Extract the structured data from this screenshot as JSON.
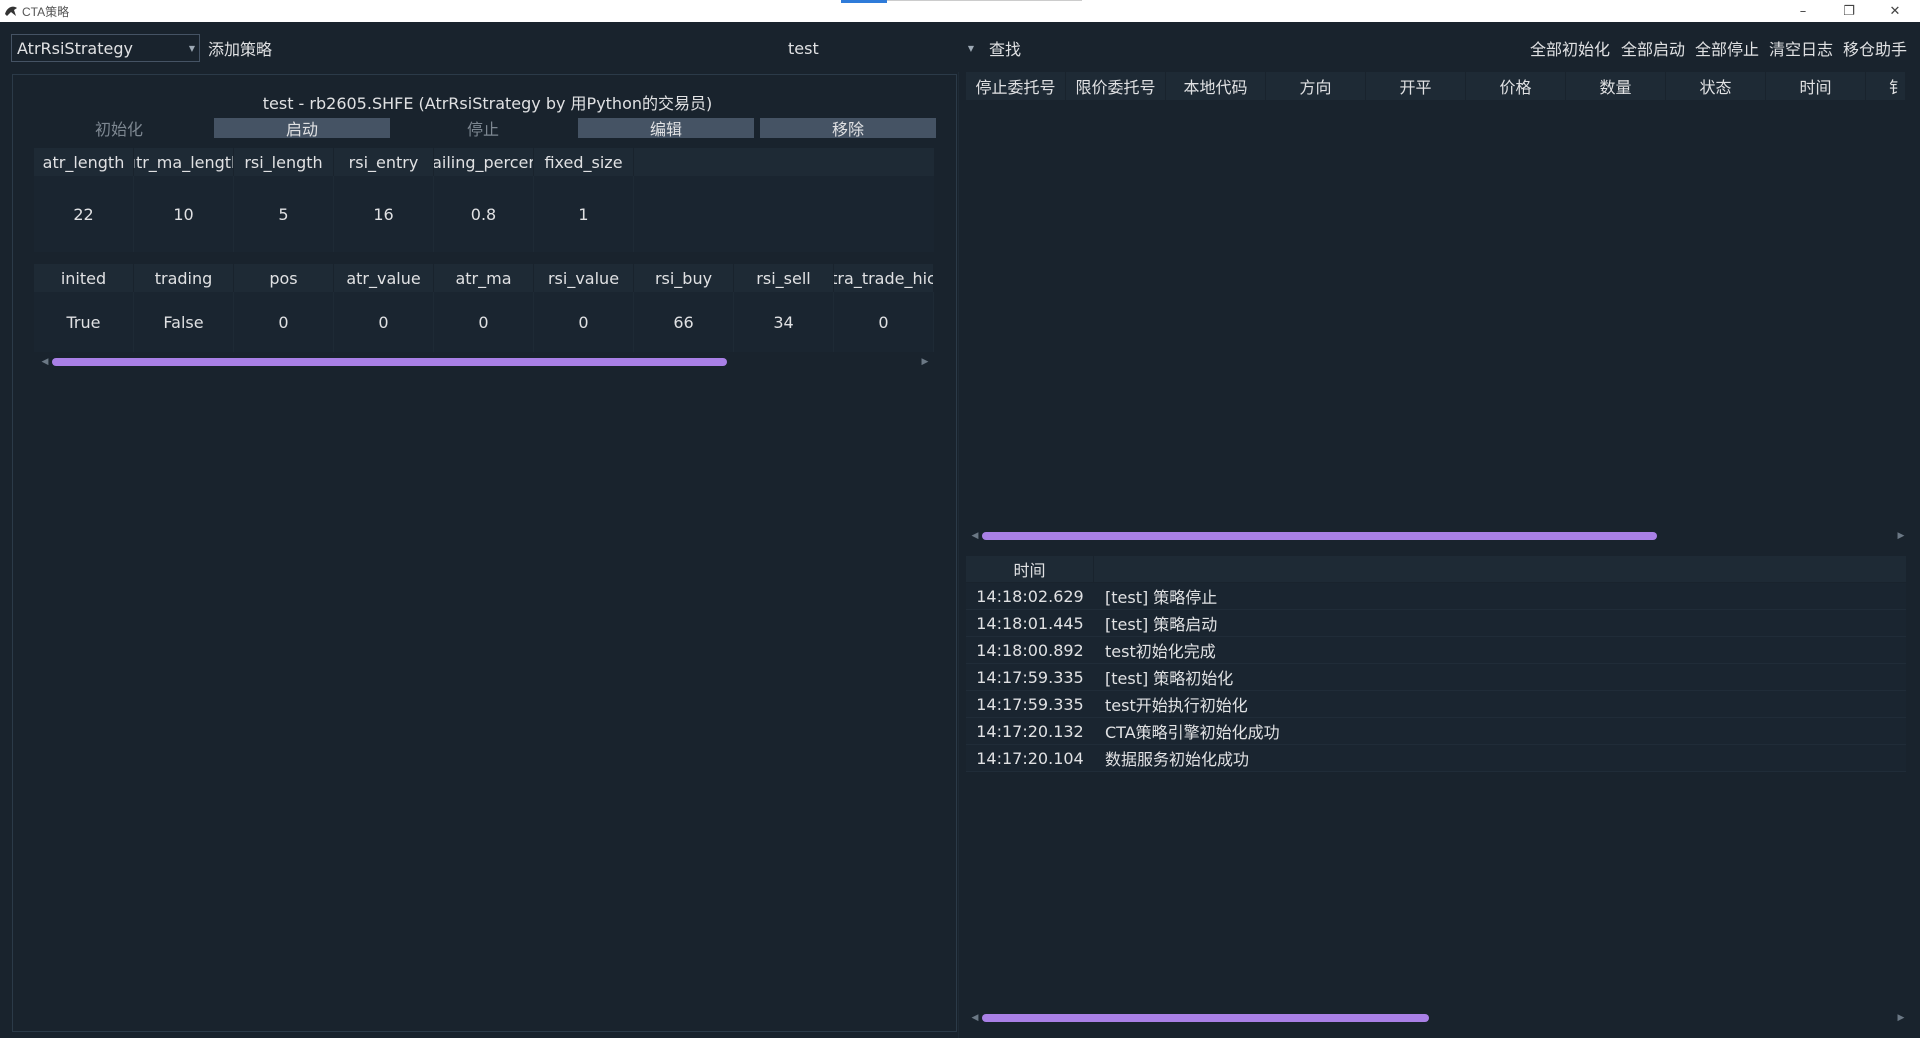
{
  "window": {
    "title": "CTA策略",
    "controls": [
      "minimize",
      "restore",
      "close"
    ]
  },
  "toolbar": {
    "strategy_class": "AtrRsiStrategy",
    "add_strategy_label": "添加策略",
    "search_value": "test",
    "search_label": "查找",
    "init_all_label": "全部初始化",
    "start_all_label": "全部启动",
    "stop_all_label": "全部停止",
    "clear_log_label": "清空日志",
    "rollover_label": "移仓助手"
  },
  "strategy": {
    "title": "test  -  rb2605.SHFE  (AtrRsiStrategy by 用Python的交易员)",
    "buttons": {
      "init": "初始化",
      "start": "启动",
      "stop": "停止",
      "edit": "编辑",
      "remove": "移除"
    },
    "parameters": {
      "headers": [
        "atr_length",
        "atr_ma_length",
        "rsi_length",
        "rsi_entry",
        "trailing_percent",
        "fixed_size"
      ],
      "header_display": [
        "atr_length",
        "ıtr_ma_lengtl",
        "rsi_length",
        "rsi_entry",
        "ailing_percer",
        "fixed_size"
      ],
      "values": [
        "22",
        "10",
        "5",
        "16",
        "0.8",
        "1"
      ]
    },
    "variables": {
      "header_display": [
        "inited",
        "trading",
        "pos",
        "atr_value",
        "atr_ma",
        "rsi_value",
        "rsi_buy",
        "rsi_sell",
        "tra_trade_hic"
      ],
      "values": [
        "True",
        "False",
        "0",
        "0",
        "0",
        "0",
        "66",
        "34",
        "0"
      ]
    },
    "variables_scroll_fraction": 0.78
  },
  "orders": {
    "headers": [
      "停止委托号",
      "限价委托号",
      "本地代码",
      "方向",
      "开平",
      "价格",
      "数量",
      "状态",
      "时间",
      "钅"
    ],
    "rows": [],
    "scroll_fraction": 0.74
  },
  "log": {
    "headers": [
      "时间",
      ""
    ],
    "rows": [
      {
        "time": "14:18:02.629",
        "msg": "[test]  策略停止"
      },
      {
        "time": "14:18:01.445",
        "msg": "[test]  策略启动"
      },
      {
        "time": "14:18:00.892",
        "msg": "test初始化完成"
      },
      {
        "time": "14:17:59.335",
        "msg": "[test]  策略初始化"
      },
      {
        "time": "14:17:59.335",
        "msg": "test开始执行初始化"
      },
      {
        "time": "14:17:20.132",
        "msg": "CTA策略引擎初始化成功"
      },
      {
        "time": "14:17:20.104",
        "msg": "数据服务初始化成功"
      }
    ],
    "scroll_fraction": 0.49
  },
  "colors": {
    "background": "#19232d",
    "header": "#1e2a35",
    "button": "#455364",
    "scroll_thumb": "#a980e6",
    "text": "#e0e1e3"
  }
}
